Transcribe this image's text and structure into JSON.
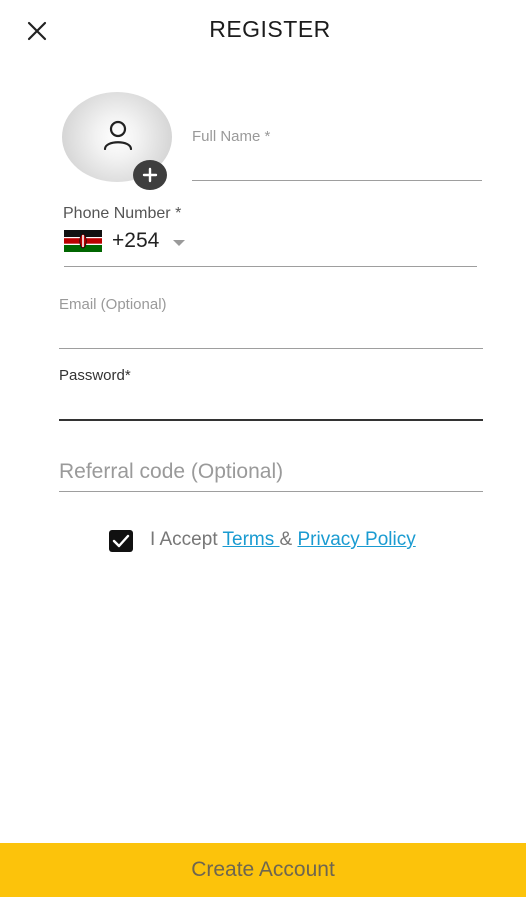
{
  "header": {
    "title": "REGISTER",
    "close_icon": "close-icon"
  },
  "avatar": {
    "icon": "person-icon",
    "add_icon": "plus-icon"
  },
  "form": {
    "full_name": {
      "placeholder": "Full Name *",
      "value": ""
    },
    "phone": {
      "label": "Phone Number *",
      "country_flag": "kenya-flag-icon",
      "dial_code": "+254",
      "value": ""
    },
    "email": {
      "placeholder": "Email (Optional)",
      "value": ""
    },
    "password": {
      "label": "Password*",
      "value": ""
    },
    "referral": {
      "placeholder": "Referral code (Optional)",
      "value": ""
    }
  },
  "consent": {
    "checked": true,
    "prefix": "I Accept ",
    "terms_link": "Terms ",
    "separator": "& ",
    "privacy_link": "Privacy Policy"
  },
  "cta": {
    "label": "Create Account"
  },
  "colors": {
    "accent": "#fcc30b",
    "link": "#1a9bd1",
    "cta_text": "#6e6650"
  }
}
